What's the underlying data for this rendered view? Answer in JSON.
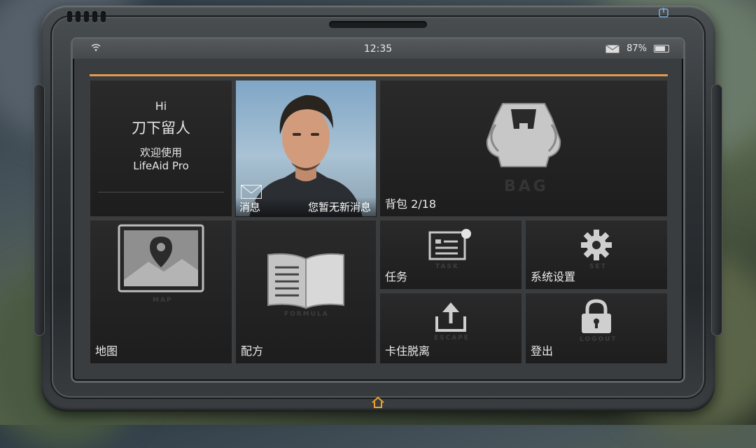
{
  "status_bar": {
    "time": "12:35",
    "battery": "87%",
    "battery_fraction": 0.87
  },
  "greeting": {
    "hi": "Hi",
    "player_name": "刀下留人",
    "welcome": "欢迎使用",
    "app_name": "LifeAid Pro"
  },
  "portrait": {
    "message_label": "消息",
    "message_status": "您暂无新消息"
  },
  "tiles": {
    "bag": {
      "label": "背包 2/18",
      "ghost": "BAG"
    },
    "map": {
      "label": "地图",
      "ghost": "MAP"
    },
    "recipe": {
      "label": "配方",
      "ghost": "FORMULA"
    },
    "task": {
      "label": "任务",
      "ghost": "TASK"
    },
    "settings": {
      "label": "系统设置",
      "ghost": "SET"
    },
    "unstuck": {
      "label": "卡住脱离",
      "ghost": "ESCAPE"
    },
    "logout": {
      "label": "登出",
      "ghost": "LOGOUT"
    }
  },
  "colors": {
    "accent_bar": "#e69a48",
    "home_button": "#f0a42a",
    "power_button": "#7fb0d8"
  },
  "icons": [
    "wifi-icon",
    "mail-icon",
    "battery-icon",
    "backpack-icon",
    "map-pin-icon",
    "open-book-icon",
    "task-list-icon",
    "gear-icon",
    "upload-icon",
    "padlock-icon",
    "power-icon",
    "home-icon"
  ]
}
